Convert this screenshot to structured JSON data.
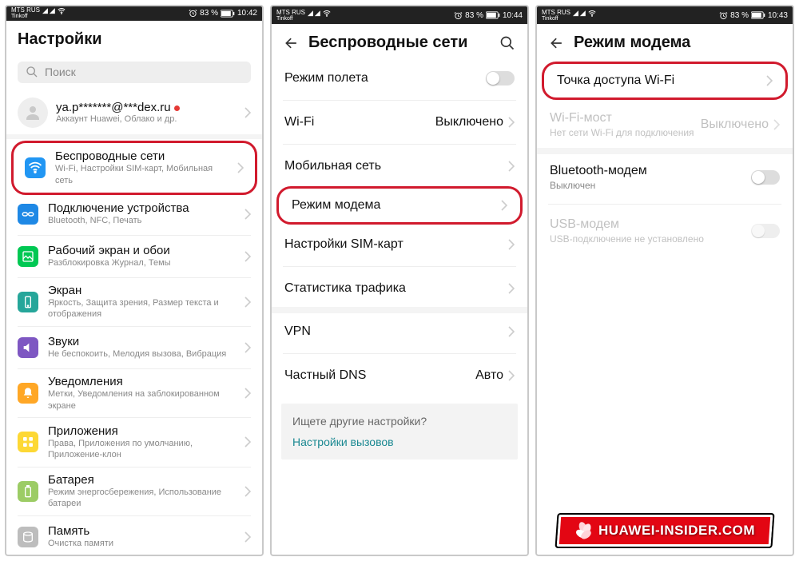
{
  "status": {
    "carrier": "MTS RUS",
    "sub": "Tinkoff",
    "battery": "83 %",
    "t1": "10:42",
    "t2": "10:44",
    "t3": "10:43"
  },
  "screen1": {
    "title": "Настройки",
    "search_placeholder": "Поиск",
    "account": {
      "title": "ya.p*******@***dex.ru",
      "sub": "Аккаунт Huawei, Облако и др."
    },
    "items": [
      {
        "title": "Беспроводные сети",
        "sub": "Wi-Fi, Настройки SIM-карт, Мобильная сеть"
      },
      {
        "title": "Подключение устройства",
        "sub": "Bluetooth, NFC, Печать"
      },
      {
        "title": "Рабочий экран и обои",
        "sub": "Разблокировка Журнал, Темы"
      },
      {
        "title": "Экран",
        "sub": "Яркость, Защита зрения, Размер текста и отображения"
      },
      {
        "title": "Звуки",
        "sub": "Не беспокоить, Мелодия вызова, Вибрация"
      },
      {
        "title": "Уведомления",
        "sub": "Метки, Уведомления на заблокированном экране"
      },
      {
        "title": "Приложения",
        "sub": "Права, Приложения по умолчанию, Приложение-клон"
      },
      {
        "title": "Батарея",
        "sub": "Режим энергосбережения, Использование батареи"
      },
      {
        "title": "Память",
        "sub": "Очистка памяти"
      }
    ]
  },
  "screen2": {
    "title": "Беспроводные сети",
    "rows": {
      "airplane": "Режим полета",
      "wifi": "Wi-Fi",
      "wifi_val": "Выключено",
      "mobile": "Мобильная сеть",
      "tether": "Режим модема",
      "sim": "Настройки SIM-карт",
      "stats": "Статистика трафика",
      "vpn": "VPN",
      "dns": "Частный DNS",
      "dns_val": "Авто"
    },
    "hint_q": "Ищете другие настройки?",
    "hint_link": "Настройки вызовов"
  },
  "screen3": {
    "title": "Режим модема",
    "rows": {
      "ap": "Точка доступа Wi-Fi",
      "bridge": "Wi-Fi-мост",
      "bridge_sub": "Нет сети Wi-Fi для подключения",
      "bridge_val": "Выключено",
      "bt": "Bluetooth-модем",
      "bt_sub": "Выключен",
      "usb": "USB-модем",
      "usb_sub": "USB-подключение не установлено"
    },
    "badge": "HUAWEI-INSIDER.COM"
  }
}
